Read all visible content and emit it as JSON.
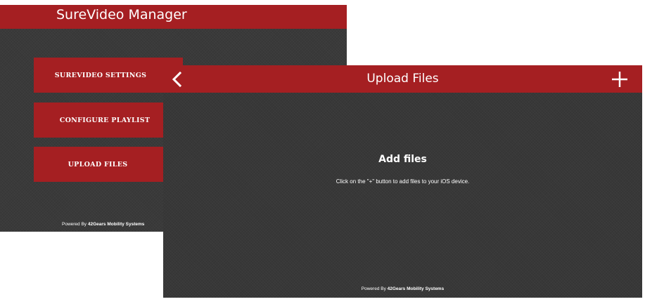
{
  "main_window": {
    "title": "SureVideo Manager",
    "menu": [
      {
        "label": "SUREVIDEO SETTINGS"
      },
      {
        "label": "CONFIGURE PLAYLIST"
      },
      {
        "label": "UPLOAD FILES"
      }
    ],
    "footer_prefix": "Powered By ",
    "footer_brand": "42Gears Mobility Systems"
  },
  "upload_window": {
    "title": "Upload Files",
    "back_icon": "chevron-left-icon",
    "add_icon": "plus-icon",
    "heading": "Add files",
    "hint": "Click on the \"+\" button to add files to your iOS device.",
    "footer_prefix": "Powered By ",
    "footer_brand": "42Gears Mobility Systems"
  },
  "colors": {
    "accent": "#a51f22",
    "background": "#3a3a3a",
    "text": "#ffffff"
  }
}
